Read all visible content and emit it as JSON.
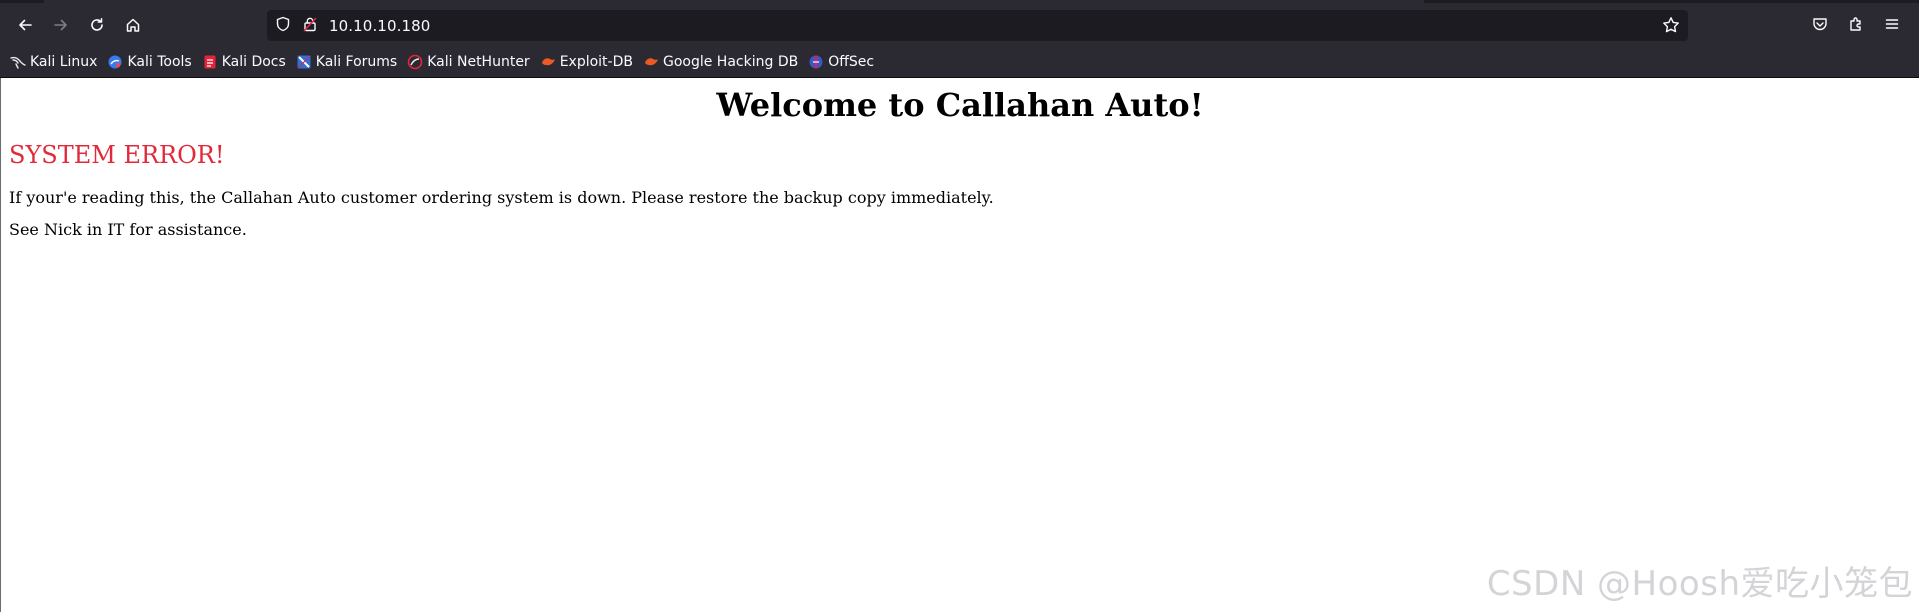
{
  "browser": {
    "url": "10.10.10.180",
    "nav": {
      "back_icon": "arrow-left-icon",
      "forward_icon": "arrow-right-icon",
      "reload_icon": "reload-icon",
      "home_icon": "home-icon"
    },
    "toolbar_icons": [
      "pocket-icon",
      "extensions-icon",
      "menu-icon"
    ],
    "colors": {
      "chrome": "#2b2a33",
      "urlbar": "#1c1b22",
      "text": "#fbfbfe"
    }
  },
  "bookmarks": [
    {
      "label": "Kali Linux",
      "icon": "kali-dragon-icon"
    },
    {
      "label": "Kali Tools",
      "icon": "kali-tools-icon"
    },
    {
      "label": "Kali Docs",
      "icon": "kali-docs-icon"
    },
    {
      "label": "Kali Forums",
      "icon": "kali-forums-icon"
    },
    {
      "label": "Kali NetHunter",
      "icon": "nethunter-icon"
    },
    {
      "label": "Exploit-DB",
      "icon": "exploit-db-icon"
    },
    {
      "label": "Google Hacking DB",
      "icon": "ghdb-icon"
    },
    {
      "label": "OffSec",
      "icon": "offsec-icon"
    }
  ],
  "page": {
    "title": "Welcome to Callahan Auto!",
    "error_heading": "SYSTEM ERROR!",
    "error_color": "#e02a3a",
    "paragraphs": [
      "If your'e reading this, the Callahan Auto customer ordering system is down. Please restore the backup copy immediately.",
      "See Nick in IT for assistance."
    ]
  },
  "watermark": "CSDN @Hoosh爱吃小笼包"
}
